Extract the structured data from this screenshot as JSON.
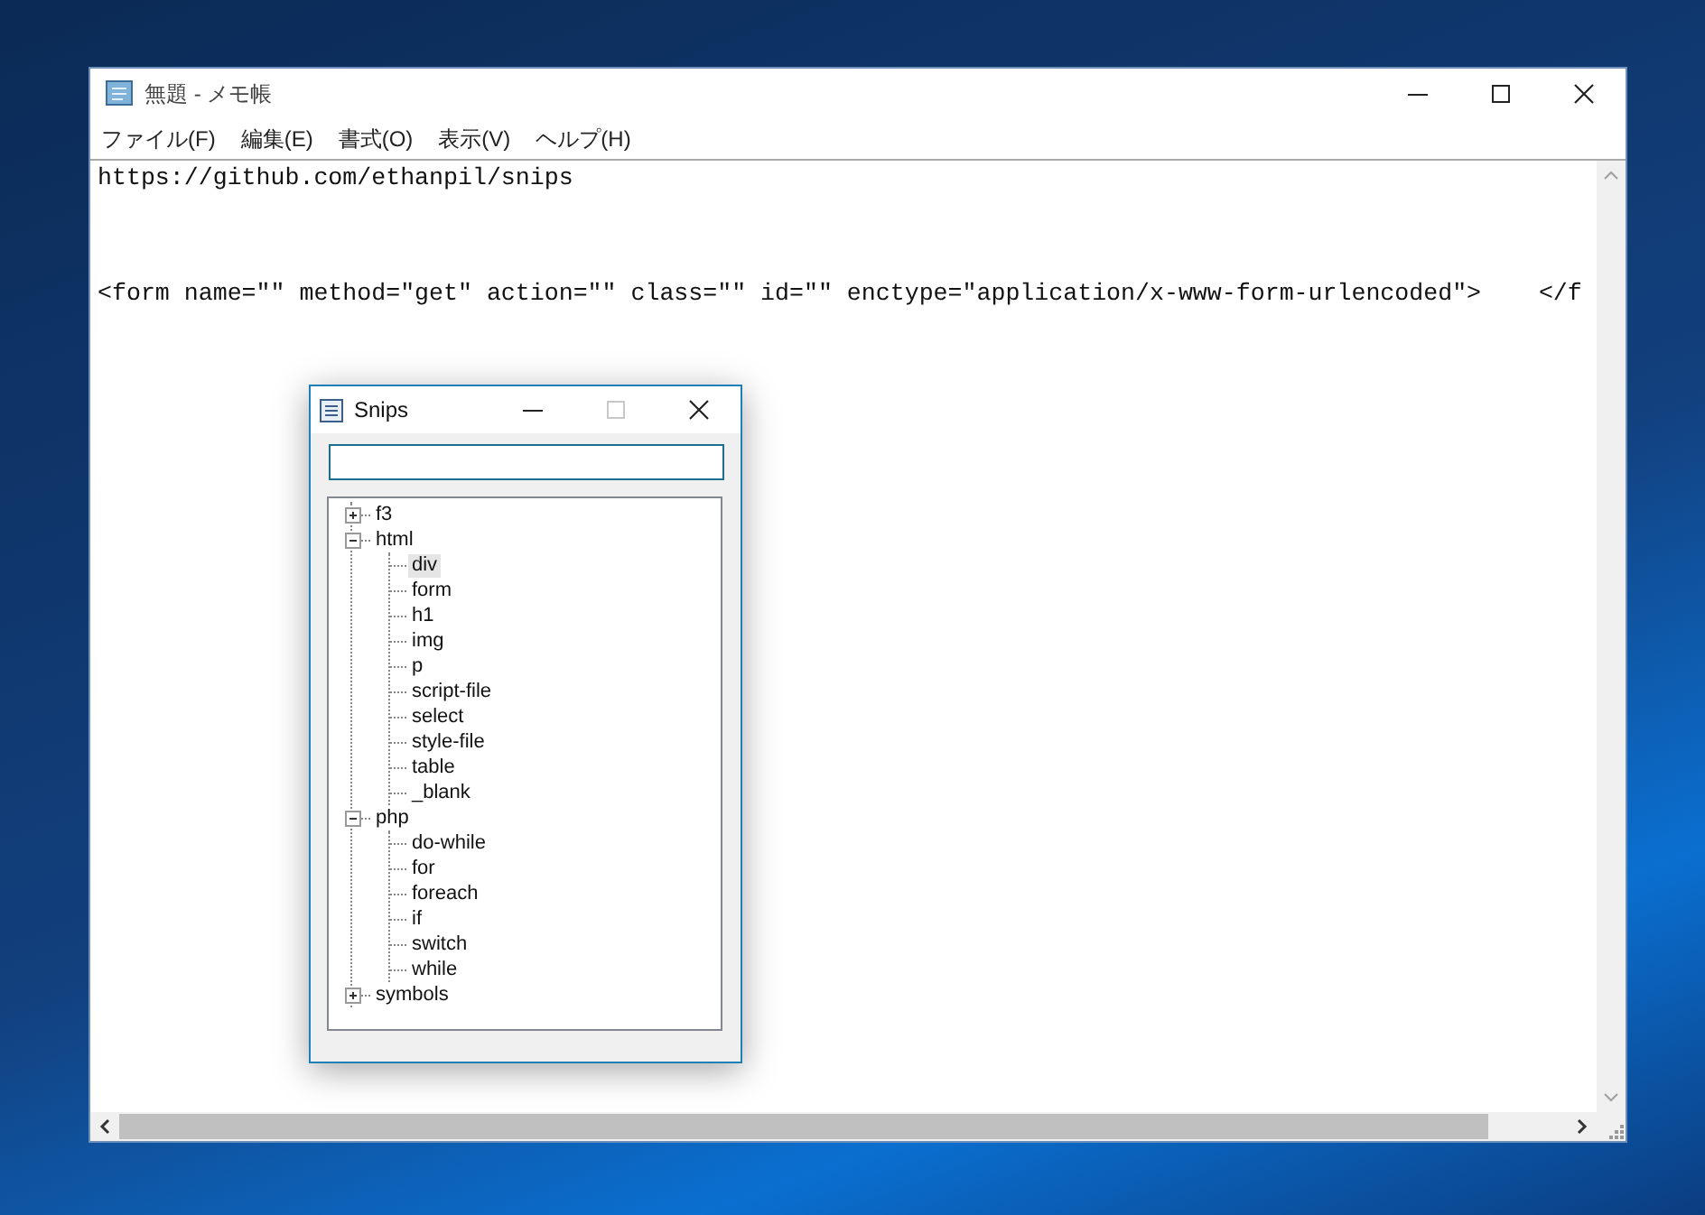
{
  "notepad": {
    "title": "無題 - メモ帳",
    "menu": [
      "ファイル(F)",
      "編集(E)",
      "書式(O)",
      "表示(V)",
      "ヘルプ(H)"
    ],
    "lines": [
      "https://github.com/ethanpil/snips",
      "<form name=\"\" method=\"get\" action=\"\" class=\"\" id=\"\" enctype=\"application/x-www-form-urlencoded\">    </f"
    ]
  },
  "snips": {
    "title": "Snips",
    "tree": [
      {
        "label": "f3",
        "expanded": false,
        "selected": false
      },
      {
        "label": "html",
        "expanded": true,
        "selected": false,
        "children": [
          {
            "label": "div",
            "selected": true
          },
          {
            "label": "form",
            "selected": false
          },
          {
            "label": "h1",
            "selected": false
          },
          {
            "label": "img",
            "selected": false
          },
          {
            "label": "p",
            "selected": false
          },
          {
            "label": "script-file",
            "selected": false
          },
          {
            "label": "select",
            "selected": false
          },
          {
            "label": "style-file",
            "selected": false
          },
          {
            "label": "table",
            "selected": false
          },
          {
            "label": "_blank",
            "selected": false
          }
        ]
      },
      {
        "label": "php",
        "expanded": true,
        "selected": false,
        "children": [
          {
            "label": "do-while",
            "selected": false
          },
          {
            "label": "for",
            "selected": false
          },
          {
            "label": "foreach",
            "selected": false
          },
          {
            "label": "if",
            "selected": false
          },
          {
            "label": "switch",
            "selected": false
          },
          {
            "label": "while",
            "selected": false
          }
        ]
      },
      {
        "label": "symbols",
        "expanded": false,
        "selected": false
      }
    ]
  }
}
